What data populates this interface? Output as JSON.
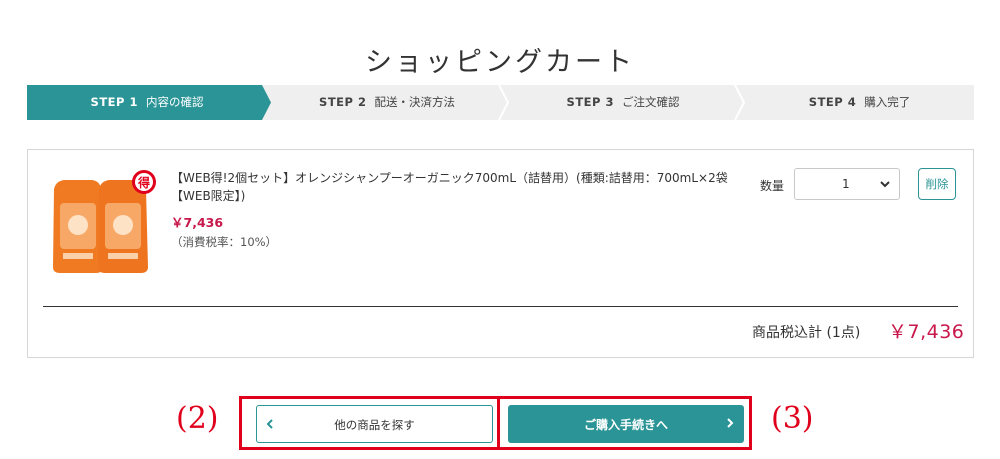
{
  "page_title": "ショッピングカート",
  "steps": [
    {
      "num": "STEP 1",
      "label": "内容の確認",
      "active": true
    },
    {
      "num": "STEP 2",
      "label": "配送・決済方法",
      "active": false
    },
    {
      "num": "STEP 3",
      "label": "ご注文確認",
      "active": false
    },
    {
      "num": "STEP 4",
      "label": "購入完了",
      "active": false
    }
  ],
  "cart": {
    "item": {
      "badge": "得",
      "name": "【WEB得!2個セット】オレンジシャンプーオーガニック700mL（詰替用）(種類:詰替用：700mL×2袋【WEB限定】)",
      "price": "￥7,436",
      "tax": "（消費税率：10%）",
      "quantity_label": "数量",
      "quantity": "1",
      "delete_label": "削除"
    },
    "total_label": "商品税込計 (1点)",
    "total_value": "￥7,436"
  },
  "buttons": {
    "back_label": "他の商品を探す",
    "next_label": "ご購入手続きへ"
  },
  "annotations": {
    "left": "(2)",
    "right": "(3)"
  },
  "colors": {
    "accent": "#2a9496",
    "price": "#c8174a",
    "annotation": "#e0001c",
    "step_inactive": "#efefef"
  }
}
